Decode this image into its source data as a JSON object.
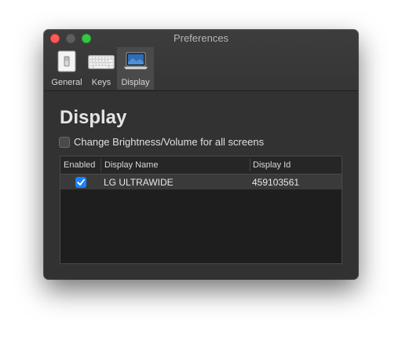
{
  "window": {
    "title": "Preferences"
  },
  "toolbar": {
    "tabs": [
      {
        "label": "General",
        "icon": "general-switch-icon"
      },
      {
        "label": "Keys",
        "icon": "keyboard-icon"
      },
      {
        "label": "Display",
        "icon": "laptop-display-icon",
        "selected": true
      }
    ]
  },
  "content": {
    "heading": "Display",
    "all_screens_checkbox": {
      "label": "Change Brightness/Volume for all screens",
      "checked": false
    },
    "table": {
      "columns": [
        "Enabled",
        "Display Name",
        "Display Id"
      ],
      "rows": [
        {
          "enabled": true,
          "name": "LG ULTRAWIDE",
          "id": "459103561"
        }
      ]
    }
  },
  "colors": {
    "accent": "#1a82fb",
    "close": "#fc5b57",
    "maximize": "#33c748",
    "window_bg": "#323232"
  }
}
